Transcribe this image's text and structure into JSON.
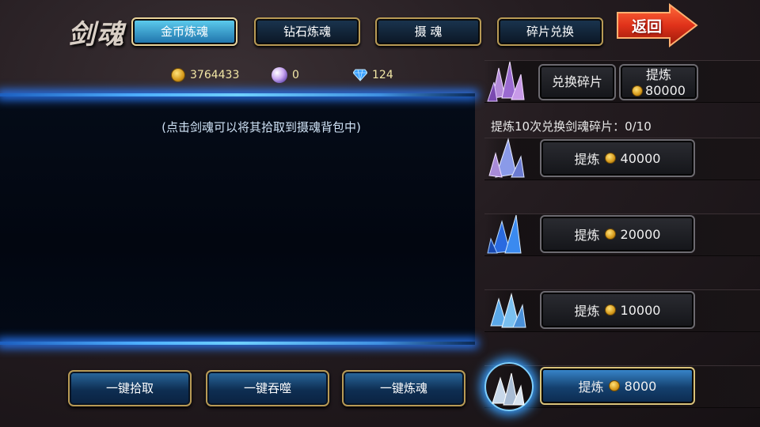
{
  "title": "剑魂",
  "tabs": [
    {
      "label": "金币炼魂",
      "active": true
    },
    {
      "label": "钻石炼魂",
      "active": false
    },
    {
      "label": "摄 魂",
      "active": false
    },
    {
      "label": "碎片兑换",
      "active": false
    }
  ],
  "back_label": "返回",
  "currency": {
    "gold": "3764433",
    "pearl": "0",
    "diamond": "124"
  },
  "panel": {
    "hint": "(点击剑魂可以将其拾取到摄魂背包中)"
  },
  "bottom_buttons": [
    "一键拾取",
    "一键吞噬",
    "一键炼魂"
  ],
  "exchange": {
    "exchange_label": "兑换碎片",
    "refine_label": "提炼",
    "refine_cost": "80000"
  },
  "progress_text": "提炼10次兑换剑魂碎片：0/10",
  "refine_rows": [
    {
      "label": "提炼",
      "cost": "40000",
      "crystal": "purple-crystal-icon",
      "active": false
    },
    {
      "label": "提炼",
      "cost": "20000",
      "crystal": "blue-crystal-icon",
      "active": false
    },
    {
      "label": "提炼",
      "cost": "10000",
      "crystal": "ice-crystal-icon",
      "active": false
    },
    {
      "label": "提炼",
      "cost": "8000",
      "crystal": "white-crystal-icon",
      "active": true
    }
  ],
  "colors": {
    "accent_blue": "#4fb0ff",
    "gold_border": "#b89a55",
    "back_red": "#e0321a"
  }
}
